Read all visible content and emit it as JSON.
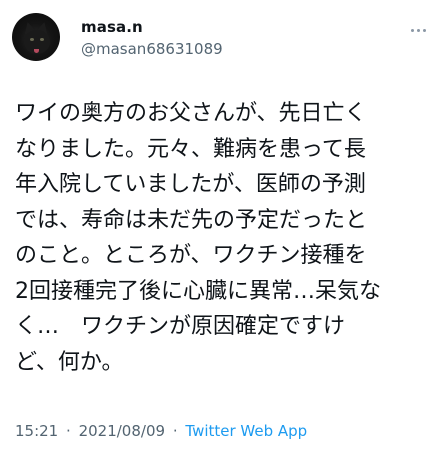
{
  "tweet": {
    "display_name": "masa.n",
    "handle": "@masan68631089",
    "avatar": "black-cat-avatar",
    "more_icon": "more-horizontal-icon",
    "body_lines": [
      "ワイの奥方のお父さんが、先日亡く",
      "なりました。元々、難病を患って長",
      "年入院していましたが、医師の予測",
      "では、寿命は未だ先の予定だったと",
      "のこと。ところが、ワクチン接種を",
      "2回接種完了後に心臓に異常…呆気な",
      "く…　ワクチンが原因確定ですけ",
      "ど、何か。"
    ],
    "time": "15:21",
    "date": "2021/08/09",
    "separator": "·",
    "source": "Twitter Web App"
  },
  "colors": {
    "text": "#0f1419",
    "secondary": "#536471",
    "link": "#1d9bf0"
  }
}
